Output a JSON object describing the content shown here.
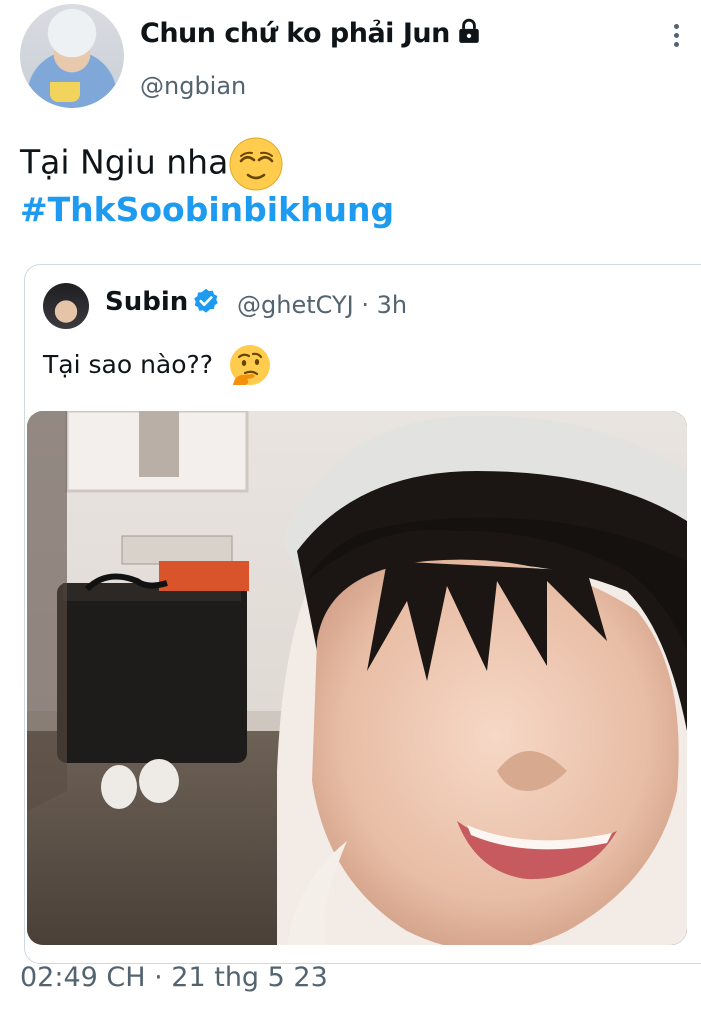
{
  "author": {
    "display_name": "Chun chứ ko phải Jun",
    "handle": "@ngbian",
    "protected_icon": "lock-icon",
    "avatar": "profile-photo"
  },
  "tweet": {
    "text": "Tại Ngiu nha",
    "emoji": "relieved-face-emoji",
    "hashtag": "#ThkSoobinbikhung",
    "timestamp": "02:49 CH · 21 thg 5 23"
  },
  "quoted_tweet": {
    "display_name": "Subin",
    "verified_icon": "verified-badge-icon",
    "meta": "@ghetCYJ · 3h",
    "text": "Tại sao nào??",
    "emoji": "thinking-face-emoji",
    "media": "selfie-photo"
  },
  "colors": {
    "link": "#1d9bf0",
    "secondary_text": "#536471",
    "primary_text": "#0f1419",
    "border": "#cfd9de"
  }
}
